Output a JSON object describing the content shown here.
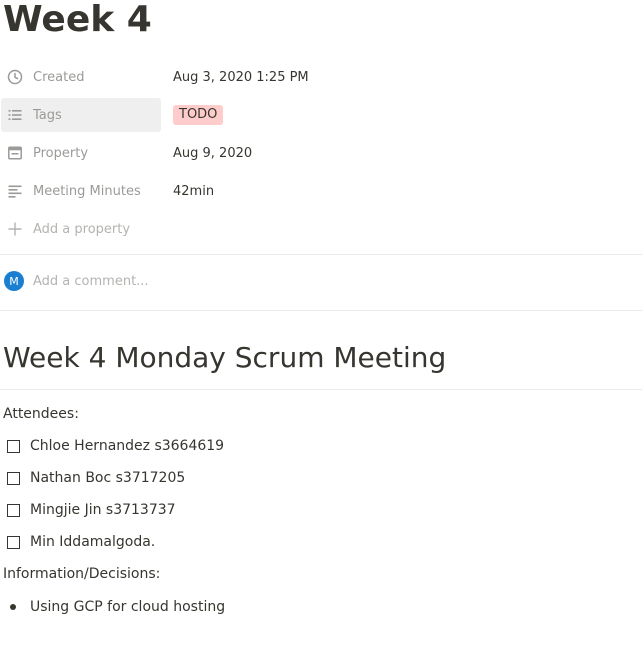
{
  "page": {
    "title": "Week 4"
  },
  "properties": [
    {
      "icon": "clock-icon",
      "label": "Created",
      "value": "Aug 3, 2020 1:25 PM"
    },
    {
      "icon": "list-icon",
      "label": "Tags",
      "tag": "TODO"
    },
    {
      "icon": "calendar-icon",
      "label": "Property",
      "value": "Aug 9, 2020"
    },
    {
      "icon": "text-lines-icon",
      "label": "Meeting Minutes",
      "value": "42min"
    }
  ],
  "add_property": {
    "icon": "plus-icon",
    "label": "Add a property"
  },
  "comment": {
    "avatar_initial": "M",
    "avatar_color": "#1a7fd1",
    "placeholder": "Add a comment..."
  },
  "content": {
    "heading": "Week 4 Monday Scrum Meeting",
    "attendees_label": "Attendees:",
    "todos": [
      {
        "label": "Chloe Hernandez s3664619",
        "checked": false
      },
      {
        "label": "Nathan Boc s3717205",
        "checked": false
      },
      {
        "label": "Mingjie Jin s3713737",
        "checked": false
      },
      {
        "label": "Min Iddamalgoda.",
        "checked": false
      }
    ],
    "info_label": "Information/Decisions:",
    "bullets": [
      "Using GCP for cloud hosting"
    ]
  },
  "colors": {
    "tag_background": "#ffcccc",
    "text": "#37352f",
    "muted": "#9b9a97"
  }
}
